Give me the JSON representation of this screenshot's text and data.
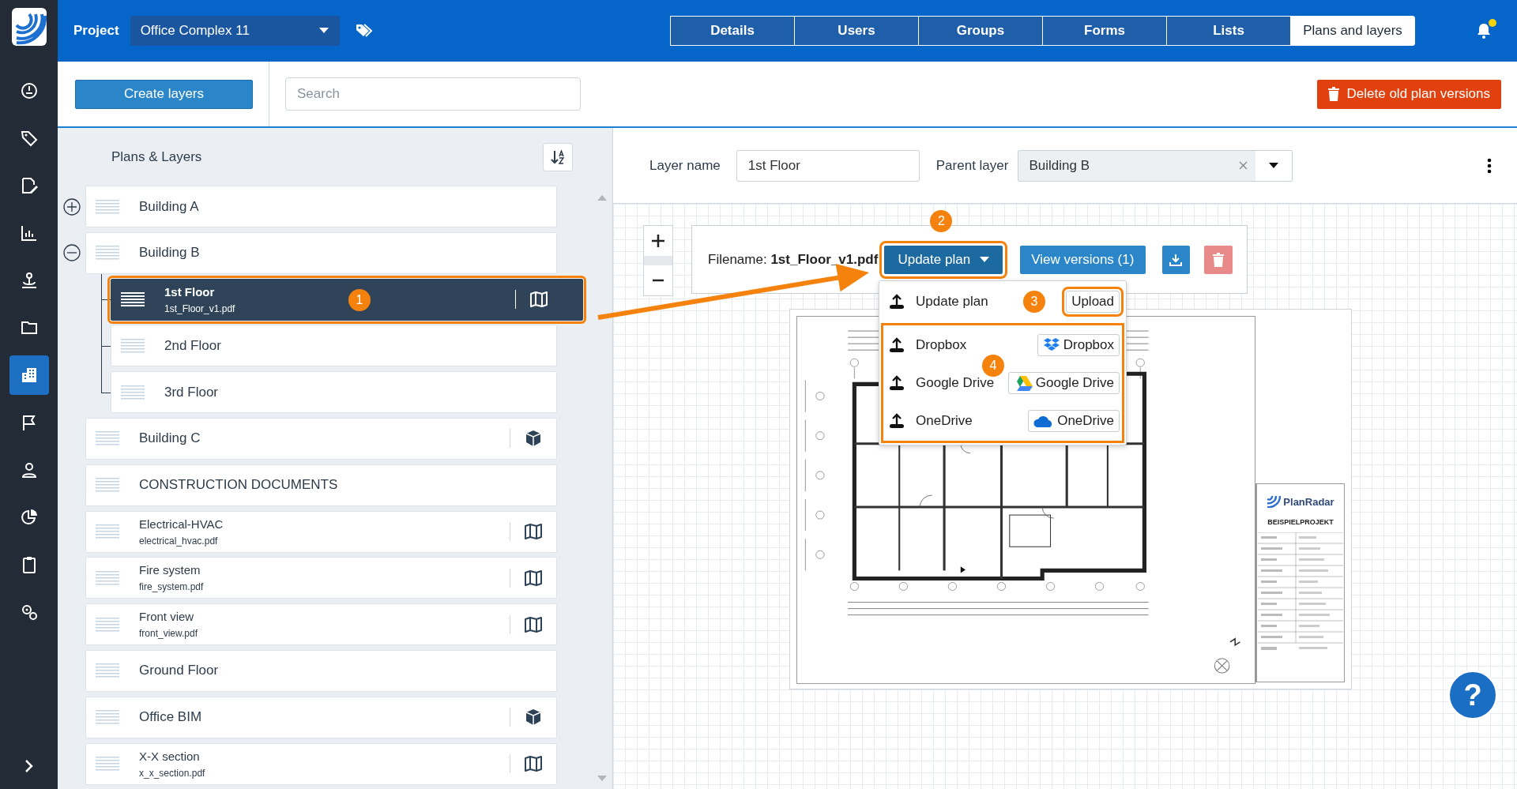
{
  "nav": {
    "items": [
      {
        "kind": "dashboard",
        "selected": false
      },
      {
        "kind": "tag",
        "selected": false
      },
      {
        "kind": "edit",
        "selected": false
      },
      {
        "kind": "chart",
        "selected": false
      },
      {
        "kind": "pin",
        "selected": false
      },
      {
        "kind": "folder",
        "selected": false
      },
      {
        "kind": "building",
        "selected": true
      },
      {
        "kind": "flag",
        "selected": false
      },
      {
        "kind": "user",
        "selected": false
      },
      {
        "kind": "pie",
        "selected": false
      },
      {
        "kind": "clipboard",
        "selected": false
      },
      {
        "kind": "settings",
        "selected": false
      }
    ]
  },
  "top_bar": {
    "project_label": "Project",
    "project": "Office Complex 11",
    "unread": true,
    "tabs": [
      {
        "label": "Details",
        "selected": false
      },
      {
        "label": "Users",
        "selected": false
      },
      {
        "label": "Groups",
        "selected": false
      },
      {
        "label": "Forms",
        "selected": false
      },
      {
        "label": "Lists",
        "selected": false
      },
      {
        "label": "Plans and layers",
        "selected": true
      }
    ]
  },
  "toolbar": {
    "create_button": "Create layers",
    "search": {
      "placeholder": "Search"
    },
    "delete_button": "Delete old plan versions"
  },
  "tree": {
    "title": "Plans & Layers",
    "items": [
      {
        "label": "Building A",
        "expanded": false,
        "selected": false
      },
      {
        "label": "Building B",
        "expanded": true,
        "selected": false,
        "children": [
          {
            "label": "1st Floor",
            "file": "1st_Floor_v1.pdf",
            "kind": "map",
            "selected": true,
            "callout": "1"
          },
          {
            "label": "2nd Floor",
            "selected": false
          },
          {
            "label": "3rd Floor",
            "selected": false
          }
        ]
      },
      {
        "label": "Building C",
        "kind": "cube",
        "selected": false
      },
      {
        "label": "CONSTRUCTION DOCUMENTS",
        "selected": false
      },
      {
        "label": "Electrical-HVAC",
        "file": "electrical_hvac.pdf",
        "kind": "map",
        "selected": false
      },
      {
        "label": "Fire system",
        "file": "fire_system.pdf",
        "kind": "map",
        "selected": false
      },
      {
        "label": "Front view",
        "file": "front_view.pdf",
        "kind": "map",
        "selected": false
      },
      {
        "label": "Ground Floor",
        "selected": false
      },
      {
        "label": "Office BIM",
        "kind": "cube",
        "selected": false
      },
      {
        "label": "X-X section",
        "file": "x_x_section.pdf",
        "kind": "map",
        "selected": false
      }
    ]
  },
  "plan": {
    "layer_name_label": "Layer name",
    "layer_name": "1st Floor",
    "parent_label": "Parent layer",
    "parent": "Building B",
    "filename": "Filename: **1st_Floor_v1.pdf**",
    "update_button": {
      "label": "Update plan",
      "callout": "2"
    },
    "versions_button": "View versions (1)",
    "menu": {
      "upload_callout": "3",
      "sources_callout": "4",
      "items": [
        {
          "label": "Update plan",
          "source": "Upload",
          "kind": "upload"
        },
        {
          "label": "Dropbox",
          "source": "Dropbox",
          "kind": "dropbox"
        },
        {
          "label": "Google Drive",
          "source": "Google Drive",
          "kind": "gdrive"
        },
        {
          "label": "OneDrive",
          "source": "OneDrive",
          "kind": "onedrive"
        }
      ]
    },
    "sheet": {
      "logo": "PlanRadar",
      "title": "BEISPIELPROJEKT"
    },
    "help": "?"
  }
}
